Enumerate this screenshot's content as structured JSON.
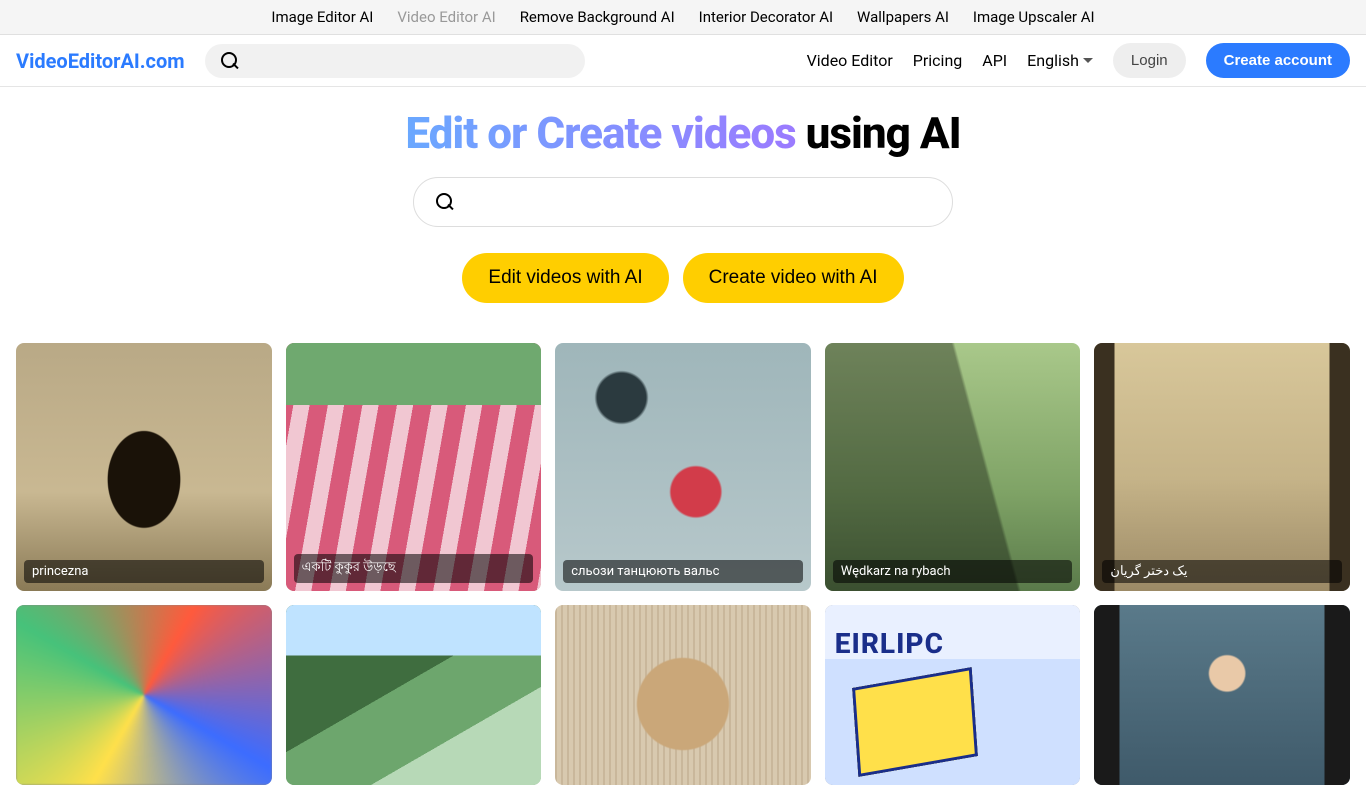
{
  "topnav": {
    "items": [
      {
        "label": "Image Editor AI",
        "active": false
      },
      {
        "label": "Video Editor AI",
        "active": true
      },
      {
        "label": "Remove Background AI",
        "active": false
      },
      {
        "label": "Interior Decorator AI",
        "active": false
      },
      {
        "label": "Wallpapers AI",
        "active": false
      },
      {
        "label": "Image Upscaler AI",
        "active": false
      }
    ]
  },
  "header": {
    "logo": "VideoEditorAI.com",
    "search_placeholder": "",
    "links": {
      "video_editor": "Video Editor",
      "pricing": "Pricing",
      "api": "API"
    },
    "language": "English",
    "login": "Login",
    "create_account": "Create account"
  },
  "hero": {
    "title_gradient": "Edit or Create videos",
    "title_rest": " using AI",
    "search_placeholder": "",
    "btn_edit": "Edit videos with AI",
    "btn_create": "Create video with AI"
  },
  "gallery": {
    "row1": [
      {
        "caption": "princezna"
      },
      {
        "caption": "একটি কুকুর উড়ছে"
      },
      {
        "caption": "сльози танцюють вальс"
      },
      {
        "caption": "Wędkarz na rybach"
      },
      {
        "caption": "یک دختر گریان"
      }
    ]
  }
}
